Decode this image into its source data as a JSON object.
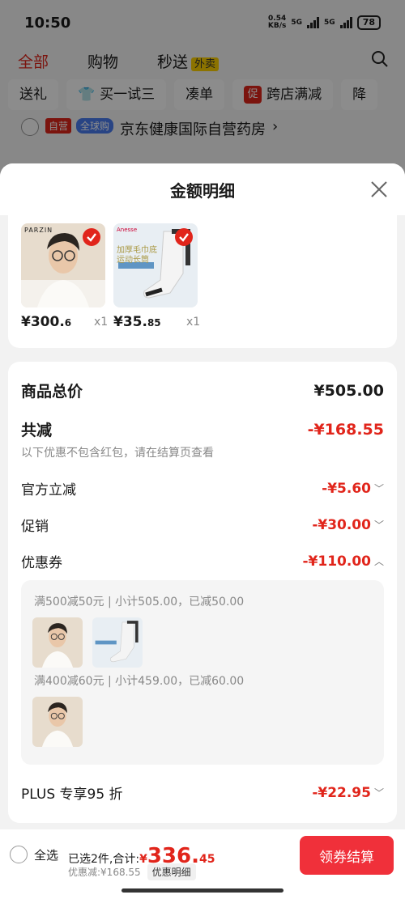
{
  "status": {
    "time": "10:50",
    "speed_top": "0.54",
    "speed_bottom": "KB/s",
    "net1": "5G",
    "net2": "5G",
    "battery": "78"
  },
  "background": {
    "tabs": [
      {
        "label": "全部",
        "active": true
      },
      {
        "label": "购物"
      },
      {
        "label": "秒送",
        "badge": "外卖"
      }
    ],
    "chips": [
      "送礼",
      "买一试三",
      "凑单",
      "跨店满减",
      "降"
    ],
    "chip_cu_icon": "促",
    "store": {
      "tag1": "自营",
      "tag2": "全球购",
      "name": "京东健康国际自营药房",
      "arrow": "›"
    }
  },
  "sheet": {
    "title": "金额明细",
    "products": [
      {
        "name": "parzin-glasses",
        "brand": "PARZIN",
        "price_int": "¥300.",
        "price_dec": "6",
        "qty": "x1"
      },
      {
        "name": "sock",
        "brand": "Anesse",
        "price_int": "¥35.",
        "price_dec": "85",
        "qty": "x1",
        "sock_text": "加厚毛巾底运动长筒"
      }
    ],
    "rows": {
      "total_label": "商品总价",
      "total_value": "¥505.00",
      "reduce_label": "共减",
      "reduce_value": "-¥168.55",
      "note": "以下优惠不包含红包，请在结算页查看",
      "official_label": "官方立减",
      "official_value": "-¥5.60",
      "promo_label": "促销",
      "promo_value": "-¥30.00",
      "coupon_label": "优惠券",
      "coupon_value": "-¥110.00",
      "plus_label": "PLUS 专享95 折",
      "plus_value": "-¥22.95"
    },
    "coupons": [
      {
        "text": "满500减50元 | 小计505.00，已减50.00"
      },
      {
        "text": "满400减60元 | 小计459.00，已减60.00"
      }
    ]
  },
  "bottom": {
    "select_all": "全选",
    "summary_prefix": "已选2件,合计:",
    "yen": "¥",
    "total_int": "336.",
    "total_dec": "45",
    "discount": "优惠减:¥168.55",
    "detail_btn": "优惠明细",
    "checkout": "领券结算"
  },
  "colors": {
    "accent": "#e1251b",
    "checkout": "#f0303a"
  }
}
